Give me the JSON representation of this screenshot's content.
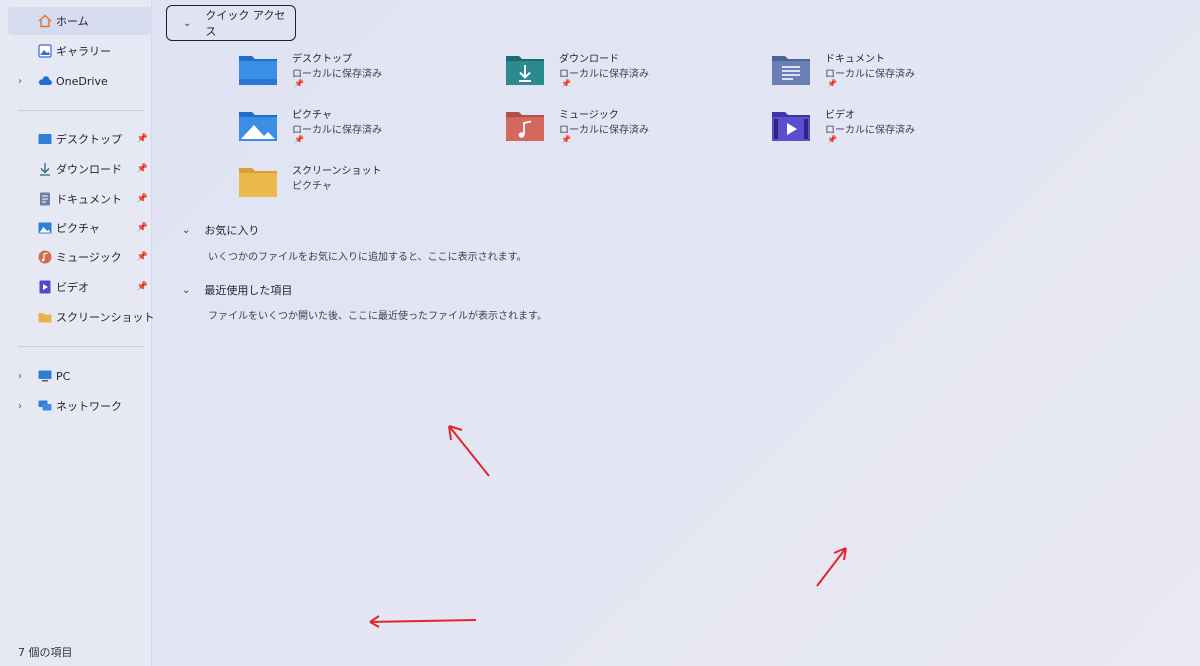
{
  "sidebar": {
    "top_items": [
      {
        "label": "ホーム",
        "icon": "home-icon",
        "selected": true
      },
      {
        "label": "ギャラリー",
        "icon": "gallery-icon"
      },
      {
        "label": "OneDrive",
        "icon": "cloud-icon",
        "expandable": true
      }
    ],
    "pinned_items": [
      {
        "label": "デスクトップ",
        "icon": "desktop-icon",
        "pinned": true
      },
      {
        "label": "ダウンロード",
        "icon": "download-icon",
        "pinned": true
      },
      {
        "label": "ドキュメント",
        "icon": "document-icon",
        "pinned": true
      },
      {
        "label": "ピクチャ",
        "icon": "picture-icon",
        "pinned": true
      },
      {
        "label": "ミュージック",
        "icon": "music-icon",
        "pinned": true
      },
      {
        "label": "ビデオ",
        "icon": "video-icon",
        "pinned": true
      },
      {
        "label": "スクリーンショット",
        "icon": "folder-icon",
        "pinned": false
      }
    ],
    "bottom_items": [
      {
        "label": "PC",
        "icon": "pc-icon",
        "expandable": true
      },
      {
        "label": "ネットワーク",
        "icon": "network-icon",
        "expandable": true
      }
    ]
  },
  "quick_access": {
    "title": "クイック アクセス",
    "items": [
      {
        "name": "デスクトップ",
        "sub": "ローカルに保存済み",
        "icon": "desktop-folder-icon",
        "pinned": true
      },
      {
        "name": "ダウンロード",
        "sub": "ローカルに保存済み",
        "icon": "download-folder-icon",
        "pinned": true
      },
      {
        "name": "ドキュメント",
        "sub": "ローカルに保存済み",
        "icon": "document-folder-icon",
        "pinned": true
      },
      {
        "name": "ピクチャ",
        "sub": "ローカルに保存済み",
        "icon": "picture-folder-icon",
        "pinned": true
      },
      {
        "name": "ミュージック",
        "sub": "ローカルに保存済み",
        "icon": "music-folder-icon",
        "pinned": true
      },
      {
        "name": "ビデオ",
        "sub": "ローカルに保存済み",
        "icon": "video-folder-icon",
        "pinned": true
      },
      {
        "name": "スクリーンショット",
        "sub": "ピクチャ",
        "icon": "yellow-folder-icon",
        "pinned": false
      }
    ]
  },
  "favorites": {
    "title": "お気に入り",
    "desc": "いくつかのファイルをお気に入りに追加すると、ここに表示されます。"
  },
  "recent": {
    "title": "最近使用した項目",
    "desc": "ファイルをいくつか開いた後、ここに最近使ったファイルが表示されます。"
  },
  "status": {
    "text": "7 個の項目"
  },
  "colors": {
    "annotation_arrow": "#e0262c",
    "accent": "#2f7fd6"
  }
}
